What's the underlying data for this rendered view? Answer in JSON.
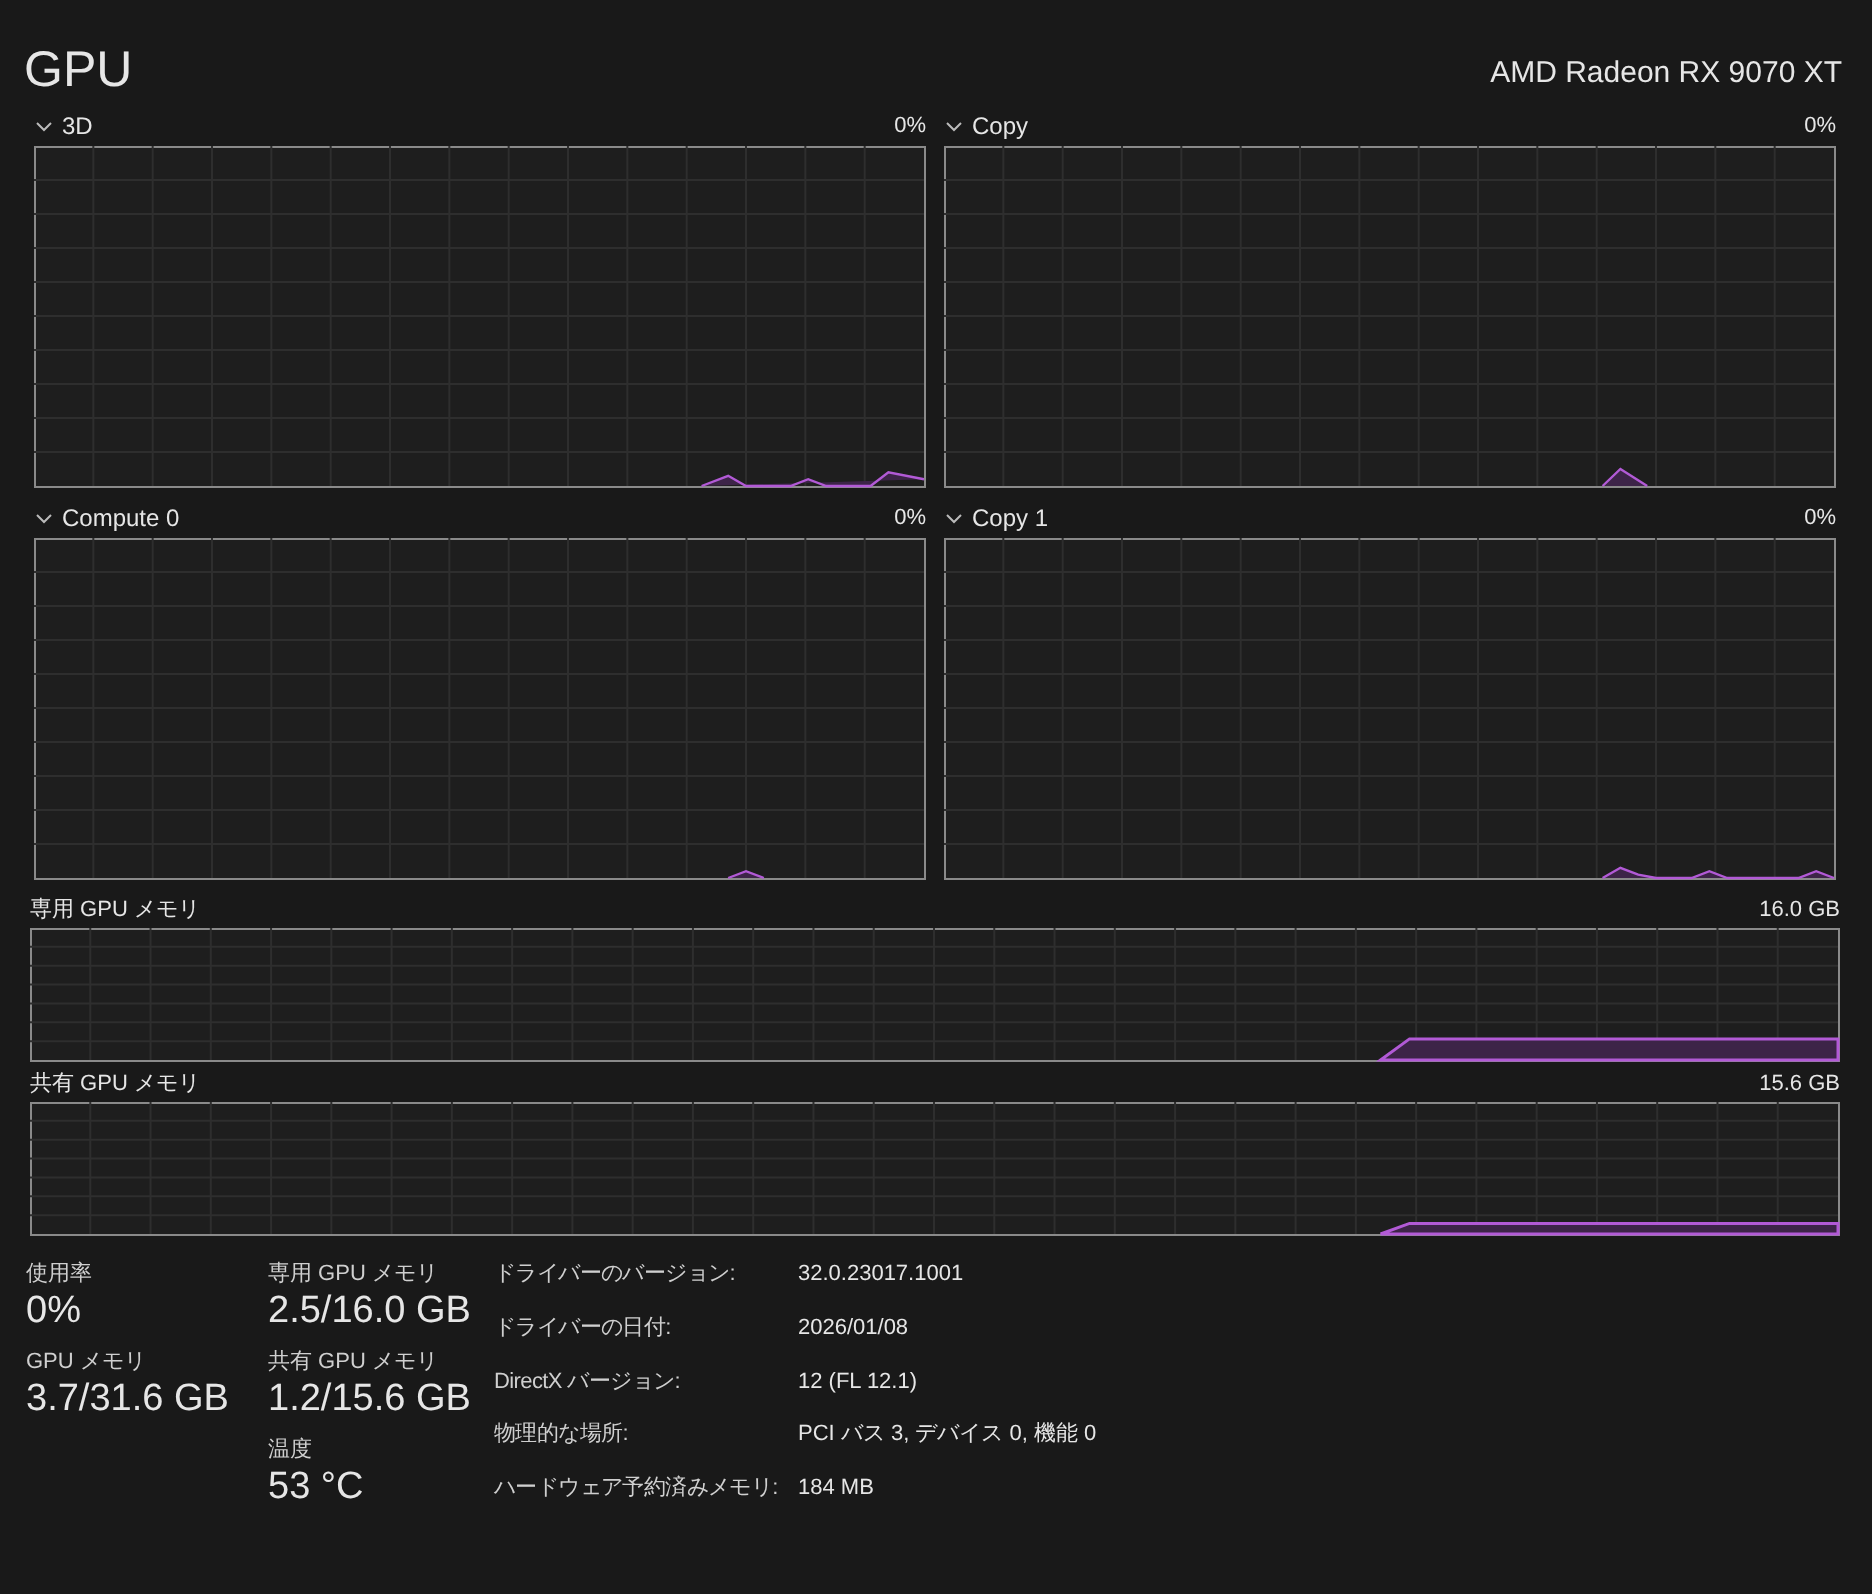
{
  "title": "GPU",
  "device": "AMD Radeon RX 9070 XT",
  "engines": [
    {
      "label": "3D",
      "reading": "0%"
    },
    {
      "label": "Copy",
      "reading": "0%"
    },
    {
      "label": "Compute 0",
      "reading": "0%"
    },
    {
      "label": "Copy 1",
      "reading": "0%"
    }
  ],
  "memory_graphs": [
    {
      "label": "専用 GPU メモリ",
      "reading": "16.0 GB"
    },
    {
      "label": "共有 GPU メモリ",
      "reading": "15.6 GB"
    }
  ],
  "stats": [
    [
      {
        "label": "使用率",
        "value": "0%"
      },
      {
        "label": "GPU メモリ",
        "value": "3.7/31.6 GB"
      }
    ],
    [
      {
        "label": "専用 GPU メモリ",
        "value": "2.5/16.0 GB"
      },
      {
        "label": "共有 GPU メモリ",
        "value": "1.2/15.6 GB"
      },
      {
        "label": "温度",
        "value": "53 °C"
      }
    ]
  ],
  "details": [
    {
      "label": "ドライバーのバージョン:",
      "value": "32.0.23017.1001"
    },
    {
      "label": "ドライバーの日付:",
      "value": "2026/01/08"
    },
    {
      "label": "DirectX バージョン:",
      "value": "12 (FL 12.1)"
    },
    {
      "label": "物理的な場所:",
      "value": "PCI バス 3, デバイス 0, 機能 0"
    },
    {
      "label": "ハードウェア予約済みメモリ:",
      "value": "184 MB"
    }
  ]
}
